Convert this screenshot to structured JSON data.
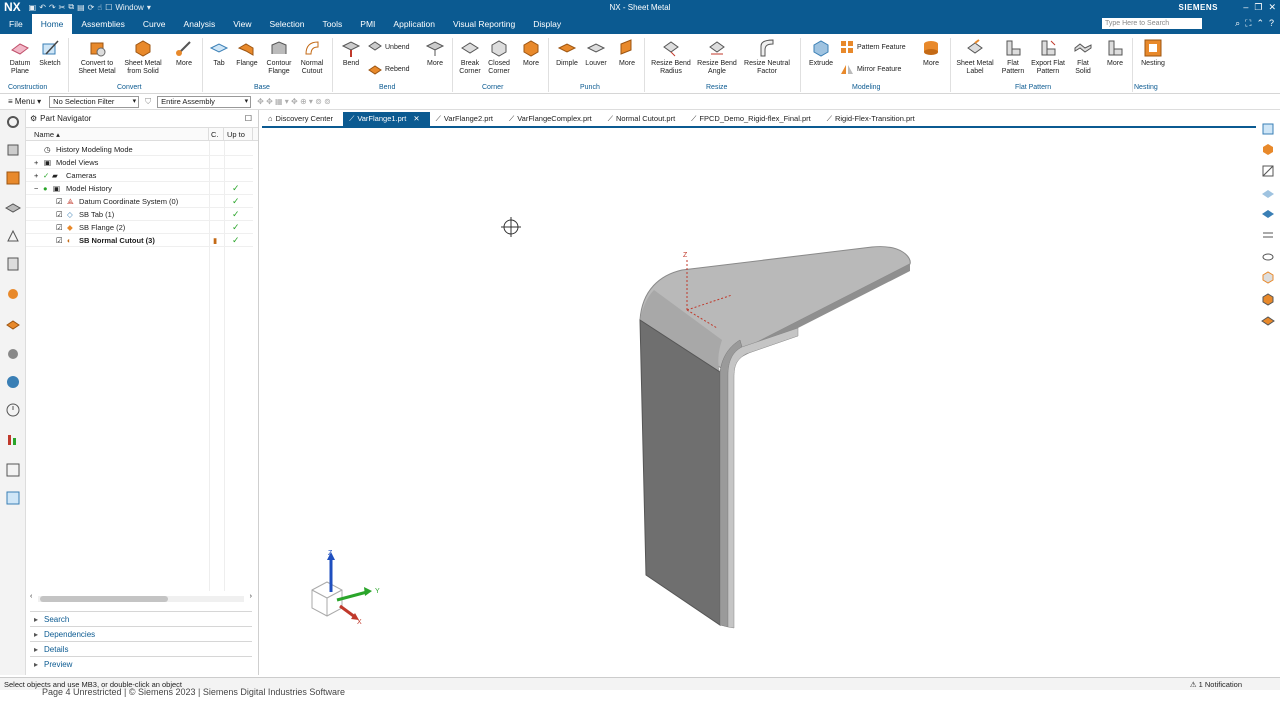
{
  "app": {
    "logo": "NX",
    "window_menu": "Window",
    "title": "NX - Sheet Metal",
    "brand": "SIEMENS",
    "search_placeholder": "Type Here to Search"
  },
  "menubar": {
    "tabs": [
      "File",
      "Home",
      "Assemblies",
      "Curve",
      "Analysis",
      "View",
      "Selection",
      "Tools",
      "PMI",
      "Application",
      "Visual Reporting",
      "Display"
    ],
    "active": "Home"
  },
  "ribbon": {
    "buttons": {
      "datum_plane": "Datum Plane",
      "sketch": "Sketch",
      "convert_to_sheet_metal": "Convert to Sheet Metal",
      "sheet_metal_from_solid": "Sheet Metal from Solid",
      "more_convert": "More",
      "tab": "Tab",
      "flange": "Flange",
      "contour_flange": "Contour Flange",
      "normal_cutout": "Normal Cutout",
      "bend": "Bend",
      "unbend": "Unbend",
      "rebend": "Rebend",
      "more_bend": "More",
      "break_corner": "Break Corner",
      "closed_corner": "Closed Corner",
      "more_corner": "More",
      "dimple": "Dimple",
      "louver": "Louver",
      "more_punch": "More",
      "resize_bend_radius": "Resize Bend Radius",
      "resize_bend_angle": "Resize Bend Angle",
      "resize_neutral_factor": "Resize Neutral Factor",
      "extrude": "Extrude",
      "pattern_feature": "Pattern Feature",
      "mirror_feature": "Mirror Feature",
      "more_modeling": "More",
      "sheet_metal_label": "Sheet Metal Label",
      "flat_pattern": "Flat Pattern",
      "export_flat_pattern": "Export Flat Pattern",
      "flat_solid": "Flat Solid",
      "more_flat": "More",
      "nesting": "Nesting"
    },
    "groups": {
      "construction": "Construction",
      "convert": "Convert",
      "base": "Base",
      "bend": "Bend",
      "corner": "Corner",
      "punch": "Punch",
      "resize": "Resize",
      "modeling": "Modeling",
      "flat_pattern": "Flat Pattern",
      "nesting": "Nesting"
    }
  },
  "selbar": {
    "menu": "Menu",
    "filter": "No Selection Filter",
    "scope": "Entire Assembly"
  },
  "navigator": {
    "title": "Part Navigator",
    "columns": [
      "Name",
      "C.",
      "Up to"
    ],
    "rows": [
      {
        "label": "History Modeling Mode"
      },
      {
        "label": "Model Views"
      },
      {
        "label": "Cameras"
      },
      {
        "label": "Model History"
      },
      {
        "label": "Datum Coordinate System (0)"
      },
      {
        "label": "SB Tab (1)"
      },
      {
        "label": "SB Flange (2)"
      },
      {
        "label": "SB Normal Cutout (3)"
      }
    ],
    "panels": [
      "Search",
      "Dependencies",
      "Details",
      "Preview"
    ]
  },
  "file_tabs": [
    {
      "label": "Discovery Center"
    },
    {
      "label": "VarFlange1.prt"
    },
    {
      "label": "VarFlange2.prt"
    },
    {
      "label": "VarFlangeComplex.prt"
    },
    {
      "label": "Normal Cutout.prt"
    },
    {
      "label": "FPCD_Demo_Rigid-flex_Final.prt"
    },
    {
      "label": "Rigid-Flex-Transition.prt"
    }
  ],
  "viewport": {
    "triad": {
      "z": "Z",
      "y": "Y",
      "x": "X"
    },
    "csys_z": "Z"
  },
  "status": {
    "message": "Select objects and use MB3, or double-click an object",
    "notification": "1 Notification"
  },
  "footer": {
    "text": "Page 4     Unrestricted | © Siemens 2023 | Siemens Digital Industries Software"
  },
  "colors": {
    "accent": "#0b5a91",
    "check": "#2aa52a",
    "orange": "#e8892b",
    "part_top": "#b9b9b9",
    "part_front": "#6f6f6f",
    "part_side": "#9a9a9a"
  }
}
